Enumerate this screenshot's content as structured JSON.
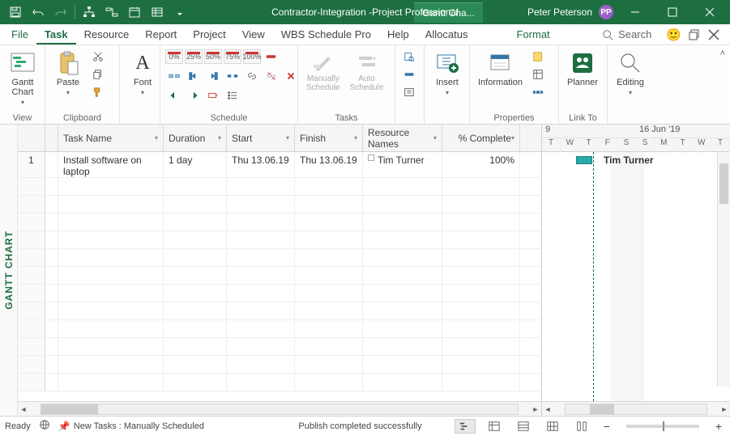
{
  "title": {
    "main": "Contractor-Integration - ",
    "suffix": "Project Professional",
    "view_tab": "Gantt Cha...",
    "user": "Peter Peterson",
    "initials": "PP"
  },
  "menu": {
    "file": "File",
    "task": "Task",
    "resource": "Resource",
    "report": "Report",
    "project": "Project",
    "view": "View",
    "wbs": "WBS Schedule Pro",
    "help": "Help",
    "allocatus": "Allocatus",
    "format": "Format",
    "search": "Search"
  },
  "ribbon": {
    "view": {
      "gantt": "Gantt\nChart",
      "label": "View"
    },
    "clipboard": {
      "paste": "Paste",
      "label": "Clipboard"
    },
    "font": {
      "font": "Font",
      "label": "Font"
    },
    "schedule": {
      "zoom": [
        "0%",
        "25%",
        "50%",
        "75%",
        "100%"
      ],
      "label": "Schedule"
    },
    "tasks": {
      "manual": "Manually\nSchedule",
      "auto": "Auto\nSchedule",
      "label": "Tasks"
    },
    "insert": {
      "btn": "Insert",
      "label": ""
    },
    "properties": {
      "info": "Information",
      "label": "Properties"
    },
    "linkto": {
      "planner": "Planner",
      "label": "Link To"
    },
    "editing": {
      "btn": "Editing"
    }
  },
  "columns": {
    "task_name": "Task Name",
    "duration": "Duration",
    "start": "Start",
    "finish": "Finish",
    "resources": "Resource\nNames",
    "pct": "% Complete"
  },
  "rows": [
    {
      "id": "1",
      "task": "Install software on laptop",
      "duration": "1 day",
      "start": "Thu 13.06.19",
      "finish": "Thu 13.06.19",
      "resource": "Tim Turner",
      "pct": "100%"
    }
  ],
  "timeline": {
    "range_left": "9",
    "range_right": "16 Jun '19",
    "days": [
      "T",
      "W",
      "T",
      "F",
      "S",
      "S",
      "M",
      "T",
      "W",
      "T"
    ],
    "bar_label": "Tim Turner"
  },
  "side_label": "GANTT CHART",
  "status": {
    "ready": "Ready",
    "new_tasks": "New Tasks : Manually Scheduled",
    "publish": "Publish completed successfully"
  }
}
